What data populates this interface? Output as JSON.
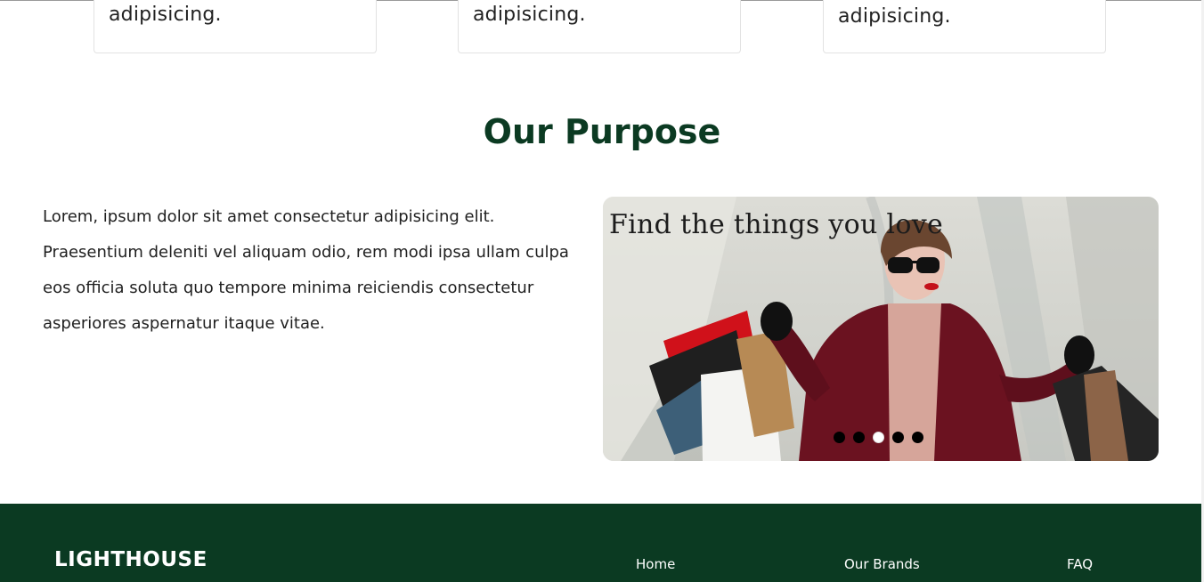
{
  "feature_cards": [
    {
      "text": "adipisicing."
    },
    {
      "text": "adipisicing."
    },
    {
      "text": "adipisicing."
    }
  ],
  "purpose": {
    "title": "Our Purpose",
    "body": "Lorem, ipsum dolor sit amet consectetur adipisicing elit. Praesentium deleniti vel aliquam odio, rem modi ipsa ullam culpa eos officia soluta quo tempore minima reiciendis consectetur asperiores aspernatur itaque vitae."
  },
  "carousel": {
    "caption": "Find the things you love",
    "slide_count": 5,
    "active_slide": 3
  },
  "footer": {
    "brand": "LIGHTHOUSE",
    "links": [
      "Home",
      "Our Brands",
      "FAQ"
    ],
    "background_color": "#0b3a22"
  },
  "colors": {
    "title": "#0b3a22",
    "text": "#1f1f1f"
  }
}
